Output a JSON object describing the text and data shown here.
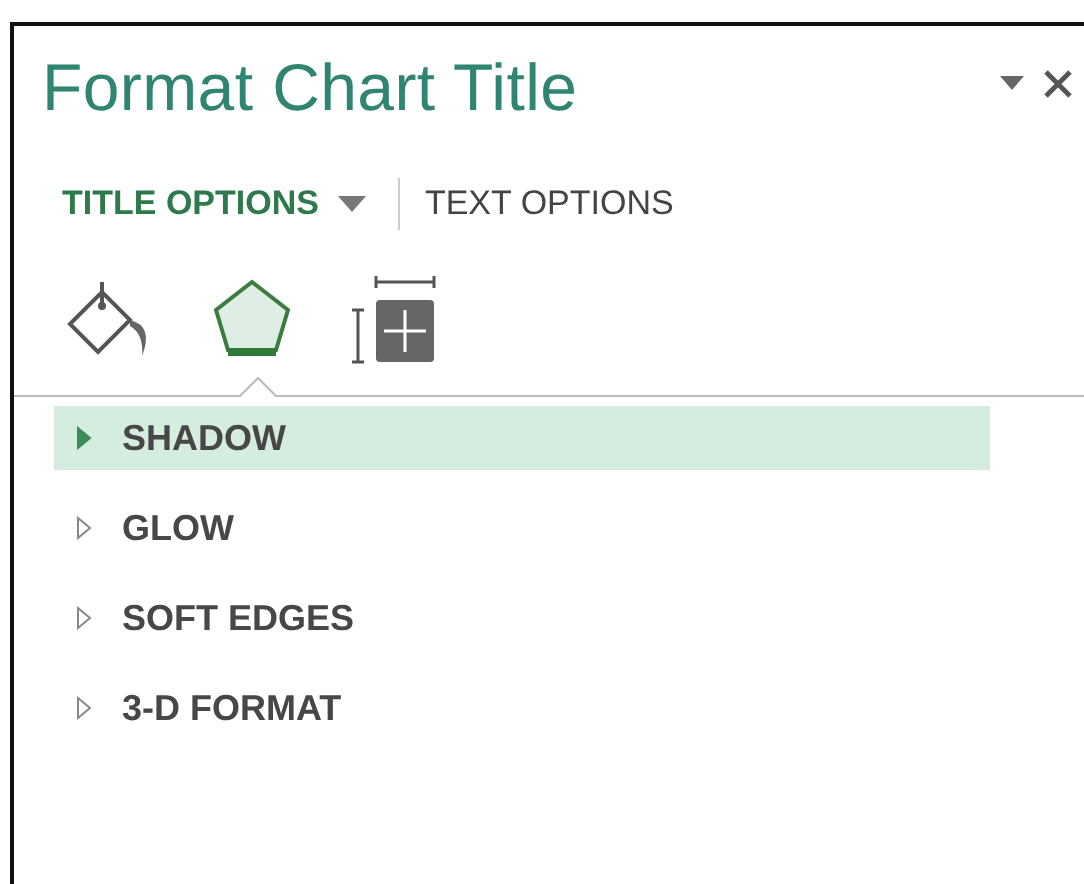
{
  "pane": {
    "title": "Format Chart Title"
  },
  "tabs": [
    {
      "label": "TITLE OPTIONS",
      "selected": true,
      "has_menu": true
    },
    {
      "label": "TEXT OPTIONS",
      "selected": false,
      "has_menu": false
    }
  ],
  "icon_tabs": [
    {
      "kind": "fill",
      "selected": false
    },
    {
      "kind": "effects",
      "selected": true
    },
    {
      "kind": "size",
      "selected": false
    }
  ],
  "sections": [
    {
      "label": "SHADOW",
      "selected": true
    },
    {
      "label": "GLOW",
      "selected": false
    },
    {
      "label": "SOFT EDGES",
      "selected": false
    },
    {
      "label": "3-D FORMAT",
      "selected": false
    }
  ]
}
